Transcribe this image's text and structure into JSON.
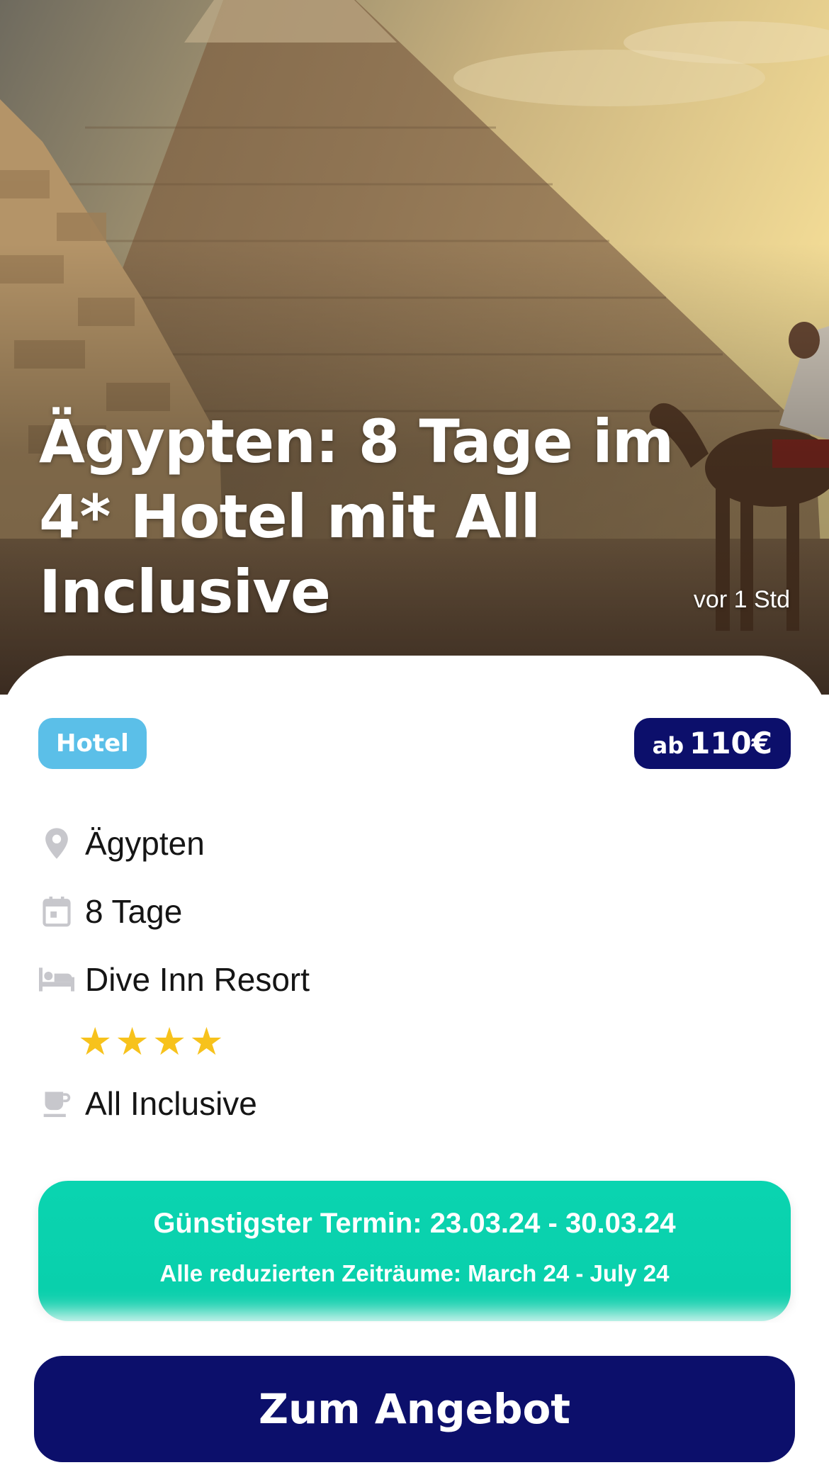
{
  "hero": {
    "title": "Ägypten: 8 Tage im 4* Hotel mit All Inclusive",
    "time_ago": "vor 1 Std"
  },
  "badges": {
    "type": "Hotel",
    "type_color": "#5bbfe8",
    "price_prefix": "ab",
    "price_amount": "110€",
    "price_color": "#0c0f6b"
  },
  "details": {
    "destination": {
      "icon": "map-pin-icon",
      "text": "Ägypten"
    },
    "duration": {
      "icon": "calendar-icon",
      "text": "8 Tage"
    },
    "hotel": {
      "icon": "bed-icon",
      "text": "Dive Inn Resort"
    },
    "stars": 4,
    "star_color": "#f7c21c",
    "board": {
      "icon": "coffee-cup-icon",
      "text": "All Inclusive"
    }
  },
  "dates": {
    "cheapest": "Günstigster Termin: 23.03.24 - 30.03.24",
    "periods": "Alle reduzierten Zeiträume: March 24 - July 24",
    "color": "#0ad4b0"
  },
  "cta": {
    "label": "Zum Angebot",
    "color": "#0c0f6b"
  }
}
